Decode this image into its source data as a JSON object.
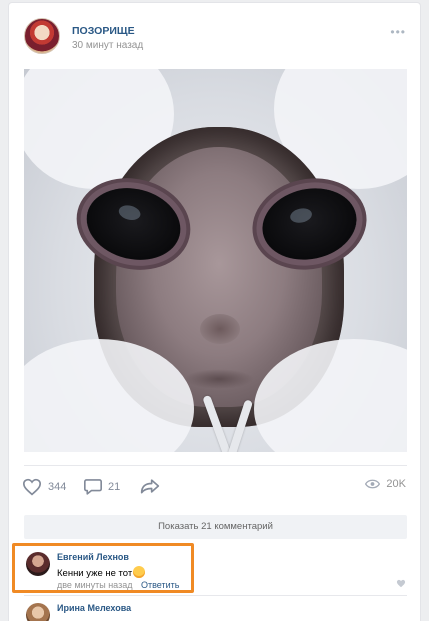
{
  "post": {
    "author": "ПОЗОРИЩЕ",
    "time": "30 минут назад",
    "more_icon": "more-dots-icon"
  },
  "actions": {
    "likes": "344",
    "comments": "21",
    "views": "20K"
  },
  "show_comments_label": "Показать 21 комментарий",
  "comment": {
    "author": "Евгений Лехнов",
    "text": "Кенни уже не тот",
    "time": "две минуты назад",
    "reply_label": "Ответить",
    "highlight_color": "#f08a24"
  },
  "next_comment": {
    "author": "Ирина Мелехова"
  },
  "colors": {
    "link": "#2a5885",
    "muted": "#939393",
    "icon": "#828a99"
  }
}
